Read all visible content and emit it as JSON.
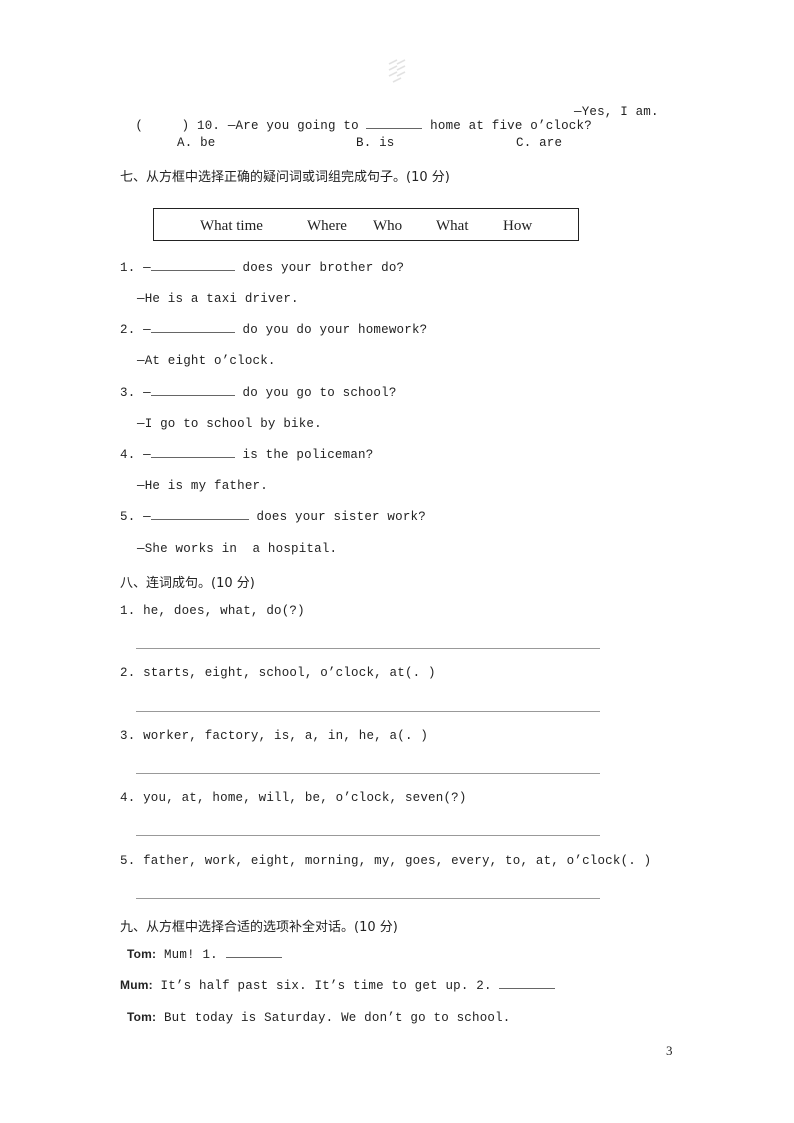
{
  "q10": {
    "paren": "(     )",
    "number": "10.",
    "prompt_before": "—Are you going to",
    "prompt_after": "home at five o’clock?",
    "response": "—Yes, I am.",
    "options": [
      "A. be",
      "B. is",
      "C. are"
    ]
  },
  "section7": {
    "heading": "七、从方框中选择正确的疑问词或词组完成句子。(10 分)",
    "word_box": [
      "What time",
      "Where",
      "Who",
      "What",
      "How"
    ],
    "items": [
      {
        "num": "1. —",
        "question": "does your brother do?",
        "answer": "—He is a taxi driver."
      },
      {
        "num": "2. —",
        "question": "do you do your homework?",
        "answer": "—At eight o’clock."
      },
      {
        "num": "3. —",
        "question": "do you go to school?",
        "answer": "—I go to school by bike."
      },
      {
        "num": "4. —",
        "question": "is the policeman?",
        "answer": "—He is my father."
      },
      {
        "num": "5. —",
        "question": "does your sister work?",
        "answer": "—She works in  a hospital."
      }
    ]
  },
  "section8": {
    "heading": "八、连词成句。(10 分)",
    "items": [
      "1. he, does, what, do(?)",
      "2. starts, eight, school, o’clock, at(. )",
      "3. worker, factory, is, a, in, he, a(. )",
      "4. you, at, home, will, be, o’clock, seven(?)",
      "5. father, work, eight, morning, my, goes, every, to, at, o’clock(. )"
    ]
  },
  "section9": {
    "heading": "九、从方框中选择合适的选项补全对话。(10 分)",
    "dialogue": [
      {
        "speaker": "Tom:",
        "text": "Mum! 1."
      },
      {
        "speaker": "Mum:",
        "text": "It’s half past six. It’s time to get up. 2."
      },
      {
        "speaker": "Tom:",
        "text": "But today is Saturday. We don’t go to school."
      }
    ]
  },
  "page_number": "3"
}
